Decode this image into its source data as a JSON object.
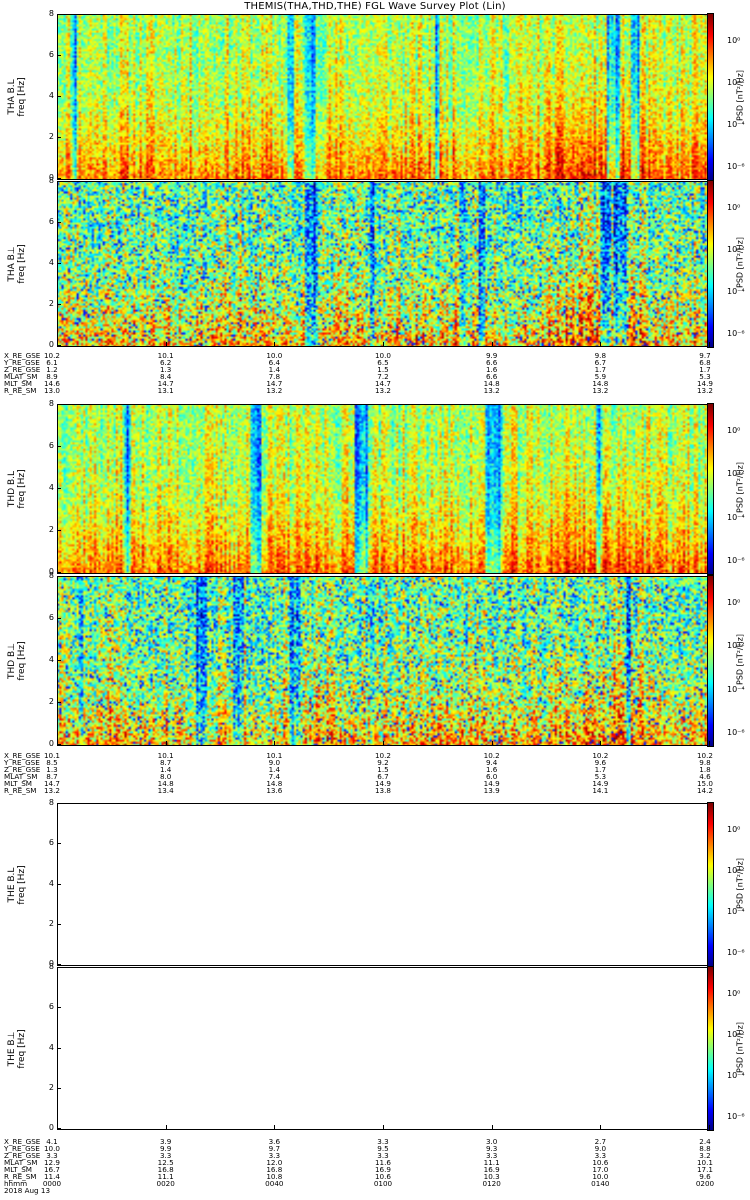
{
  "title": "THEMIS(THA,THD,THE) FGL Wave Survey Plot (Lin)",
  "colorbar_label": "PSD [nT²/Hz]",
  "colorbar_ticks": [
    "10⁰",
    "10⁻²",
    "10⁻⁴",
    "10⁻⁶"
  ],
  "ylabel_unit": "freq [Hz]",
  "yticks": [
    "8",
    "6",
    "4",
    "2",
    "0"
  ],
  "groups": [
    {
      "panels": [
        {
          "probe": "THA B.L",
          "data": true,
          "seed": 11
        },
        {
          "probe": "THA B⊥",
          "data": true,
          "seed": 23
        }
      ],
      "ephemeris": [
        {
          "name": "X_RE_GSE",
          "values": [
            "10.2",
            "10.1",
            "10.0",
            "10.0",
            "9.9",
            "9.8",
            "9.7"
          ]
        },
        {
          "name": "Y_RE_GSE",
          "values": [
            "6.1",
            "6.2",
            "6.4",
            "6.5",
            "6.6",
            "6.7",
            "6.8"
          ]
        },
        {
          "name": "Z_RE_GSE",
          "values": [
            "1.2",
            "1.3",
            "1.4",
            "1.5",
            "1.6",
            "1.7",
            "1.7"
          ]
        },
        {
          "name": "MLAT_SM",
          "values": [
            "8.9",
            "8.4",
            "7.8",
            "7.2",
            "6.6",
            "5.9",
            "5.3"
          ]
        },
        {
          "name": "MLT_SM",
          "values": [
            "14.6",
            "14.7",
            "14.7",
            "14.7",
            "14.8",
            "14.8",
            "14.9"
          ]
        },
        {
          "name": "R_RE_SM",
          "values": [
            "13.0",
            "13.1",
            "13.2",
            "13.2",
            "13.2",
            "13.2",
            "13.2"
          ]
        }
      ]
    },
    {
      "panels": [
        {
          "probe": "THD B.L",
          "data": true,
          "seed": 37
        },
        {
          "probe": "THD B⊥",
          "data": true,
          "seed": 51
        }
      ],
      "ephemeris": [
        {
          "name": "X_RE_GSE",
          "values": [
            "10.1",
            "10.1",
            "10.1",
            "10.2",
            "10.2",
            "10.2",
            "10.2"
          ]
        },
        {
          "name": "Y_RE_GSE",
          "values": [
            "8.5",
            "8.7",
            "9.0",
            "9.2",
            "9.4",
            "9.6",
            "9.8"
          ]
        },
        {
          "name": "Z_RE_GSE",
          "values": [
            "1.3",
            "1.4",
            "1.4",
            "1.5",
            "1.6",
            "1.7",
            "1.8"
          ]
        },
        {
          "name": "MLAT_SM",
          "values": [
            "8.7",
            "8.0",
            "7.4",
            "6.7",
            "6.0",
            "5.3",
            "4.6"
          ]
        },
        {
          "name": "MLT_SM",
          "values": [
            "14.7",
            "14.8",
            "14.8",
            "14.9",
            "14.9",
            "14.9",
            "15.0"
          ]
        },
        {
          "name": "R_RE_SM",
          "values": [
            "13.2",
            "13.4",
            "13.6",
            "13.8",
            "13.9",
            "14.1",
            "14.2"
          ]
        }
      ]
    },
    {
      "panels": [
        {
          "probe": "THE B.L",
          "data": false,
          "seed": 0
        },
        {
          "probe": "THE B⊥",
          "data": false,
          "seed": 0
        }
      ],
      "ephemeris": [
        {
          "name": "X_RE_GSE",
          "values": [
            "4.1",
            "3.9",
            "3.6",
            "3.3",
            "3.0",
            "2.7",
            "2.4"
          ]
        },
        {
          "name": "Y_RE_GSE",
          "values": [
            "10.0",
            "9.9",
            "9.7",
            "9.5",
            "9.3",
            "9.0",
            "8.8"
          ]
        },
        {
          "name": "Z_RE_GSE",
          "values": [
            "3.3",
            "3.3",
            "3.3",
            "3.3",
            "3.3",
            "3.3",
            "3.2"
          ]
        },
        {
          "name": "MLAT_SM",
          "values": [
            "12.9",
            "12.5",
            "12.0",
            "11.6",
            "11.1",
            "10.6",
            "10.1"
          ]
        },
        {
          "name": "MLT_SM",
          "values": [
            "16.7",
            "16.8",
            "16.8",
            "16.9",
            "16.9",
            "17.0",
            "17.1"
          ]
        },
        {
          "name": "R_RE_SM",
          "values": [
            "11.4",
            "11.1",
            "10.8",
            "10.6",
            "10.3",
            "10.0",
            "9.6"
          ]
        },
        {
          "name": "hhmm",
          "values": [
            "0000",
            "0020",
            "0040",
            "0100",
            "0120",
            "0140",
            "0200"
          ]
        }
      ],
      "date": "2018 Aug 13"
    }
  ],
  "chart_data": {
    "type": "heatmap",
    "title": "THEMIS(THA,THD,THE) FGL Wave Survey Plot (Lin)",
    "x_axis": {
      "label": "hhmm",
      "ticks": [
        "0000",
        "0020",
        "0040",
        "0100",
        "0120",
        "0140",
        "0200"
      ],
      "date": "2018 Aug 13"
    },
    "y_axis": {
      "label": "freq [Hz]",
      "range": [
        0,
        8
      ],
      "ticks": [
        0,
        2,
        4,
        6,
        8
      ]
    },
    "colorbar": {
      "label": "PSD [nT²/Hz]",
      "scale": "log",
      "range": [
        1e-07,
        10.0
      ],
      "ticks": [
        "10⁰",
        "10⁻²",
        "10⁻⁴",
        "10⁻⁶"
      ]
    },
    "panels": [
      "THA B.L",
      "THA B⊥",
      "THD B.L",
      "THD B⊥",
      "THE B.L",
      "THE B⊥"
    ],
    "notes": "THA and THD panels contain dense spectrogram data; THE panels are empty."
  }
}
